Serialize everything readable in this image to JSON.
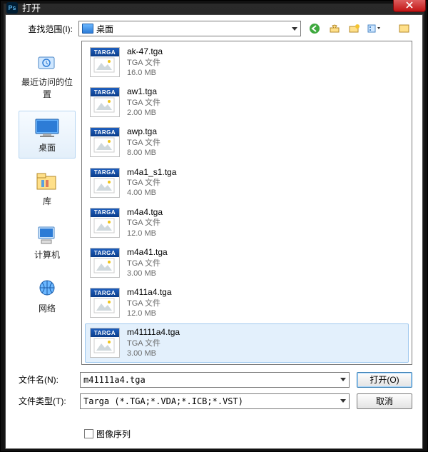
{
  "window": {
    "title": "打开",
    "app_icon_label": "Ps"
  },
  "lookin": {
    "label": "查找范围(I):",
    "value": "桌面"
  },
  "toolbar_icons": [
    "back-icon",
    "up-icon",
    "new-folder-icon",
    "views-icon",
    "preview-icon"
  ],
  "places": [
    {
      "id": "recent",
      "label": "最近访问的位置"
    },
    {
      "id": "desktop",
      "label": "桌面",
      "selected": true
    },
    {
      "id": "libraries",
      "label": "库"
    },
    {
      "id": "computer",
      "label": "计算机"
    },
    {
      "id": "network",
      "label": "网络"
    }
  ],
  "thumb_badge": "TARGA",
  "files": [
    {
      "name": "ak-47.tga",
      "type": "TGA 文件",
      "size": "16.0 MB"
    },
    {
      "name": "aw1.tga",
      "type": "TGA 文件",
      "size": "2.00 MB"
    },
    {
      "name": "awp.tga",
      "type": "TGA 文件",
      "size": "8.00 MB"
    },
    {
      "name": "m4a1_s1.tga",
      "type": "TGA 文件",
      "size": "4.00 MB"
    },
    {
      "name": "m4a4.tga",
      "type": "TGA 文件",
      "size": "12.0 MB"
    },
    {
      "name": "m4a41.tga",
      "type": "TGA 文件",
      "size": "3.00 MB"
    },
    {
      "name": "m411a4.tga",
      "type": "TGA 文件",
      "size": "12.0 MB"
    },
    {
      "name": "m41111a4.tga",
      "type": "TGA 文件",
      "size": "3.00 MB",
      "selected": true
    }
  ],
  "filename": {
    "label": "文件名(N):",
    "value": "m41111a4.tga"
  },
  "filetype": {
    "label": "文件类型(T):",
    "value": "Targa (*.TGA;*.VDA;*.ICB;*.VST)"
  },
  "buttons": {
    "open": "打开(O)",
    "cancel": "取消"
  },
  "checkbox": {
    "label": "图像序列"
  }
}
